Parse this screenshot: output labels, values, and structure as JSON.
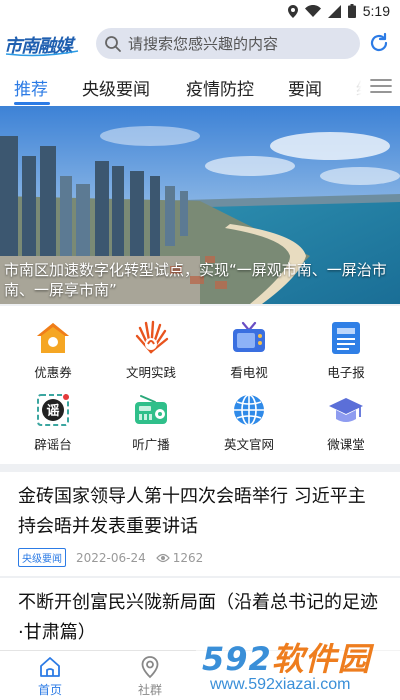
{
  "status_bar": {
    "time": "5:19",
    "icons": [
      "location-icon",
      "wifi-icon",
      "signal-icon",
      "battery-icon"
    ]
  },
  "header": {
    "logo_text": "市南融媒",
    "search_placeholder": "请搜索您感兴趣的内容"
  },
  "tabs": [
    {
      "label": "推荐",
      "active": true
    },
    {
      "label": "央级要闻",
      "active": false
    },
    {
      "label": "疫情防控",
      "active": false
    },
    {
      "label": "要闻",
      "active": false
    },
    {
      "label": "经",
      "active": false
    }
  ],
  "banner": {
    "caption": "市南区加速数字化转型试点，实现“一屏观市南、一屏治市南、一屏享市南”"
  },
  "services": [
    {
      "label": "优惠券",
      "icon": "coupon-icon"
    },
    {
      "label": "文明实践",
      "icon": "civilization-practice-icon"
    },
    {
      "label": "看电视",
      "icon": "tv-icon"
    },
    {
      "label": "电子报",
      "icon": "newspaper-icon"
    },
    {
      "label": "辟谣台",
      "icon": "rumor-refute-icon"
    },
    {
      "label": "听广播",
      "icon": "radio-icon"
    },
    {
      "label": "英文官网",
      "icon": "globe-icon"
    },
    {
      "label": "微课堂",
      "icon": "graduation-cap-icon"
    }
  ],
  "services_extra": {
    "rumor_glyph": "谣"
  },
  "news": [
    {
      "title": "金砖国家领导人第十四次会晤举行 习近平主持会晤并发表重要讲话",
      "badge": "央级要闻",
      "date": "2022-06-24",
      "views": "1262"
    },
    {
      "title": "不断开创富民兴陇新局面（沿着总书记的足迹·甘肃篇）"
    }
  ],
  "bottom_nav": [
    {
      "label": "首页",
      "icon": "home-icon",
      "active": true
    },
    {
      "label": "社群",
      "icon": "location-pin-icon",
      "active": false
    }
  ],
  "watermark": {
    "brand_num": "592",
    "brand_text": "软件园",
    "url": "www.592xiazai.com"
  },
  "colors": {
    "accent": "#2c7be5",
    "search_bg": "#dfe3ee",
    "page_bg": "#eef0f3"
  }
}
